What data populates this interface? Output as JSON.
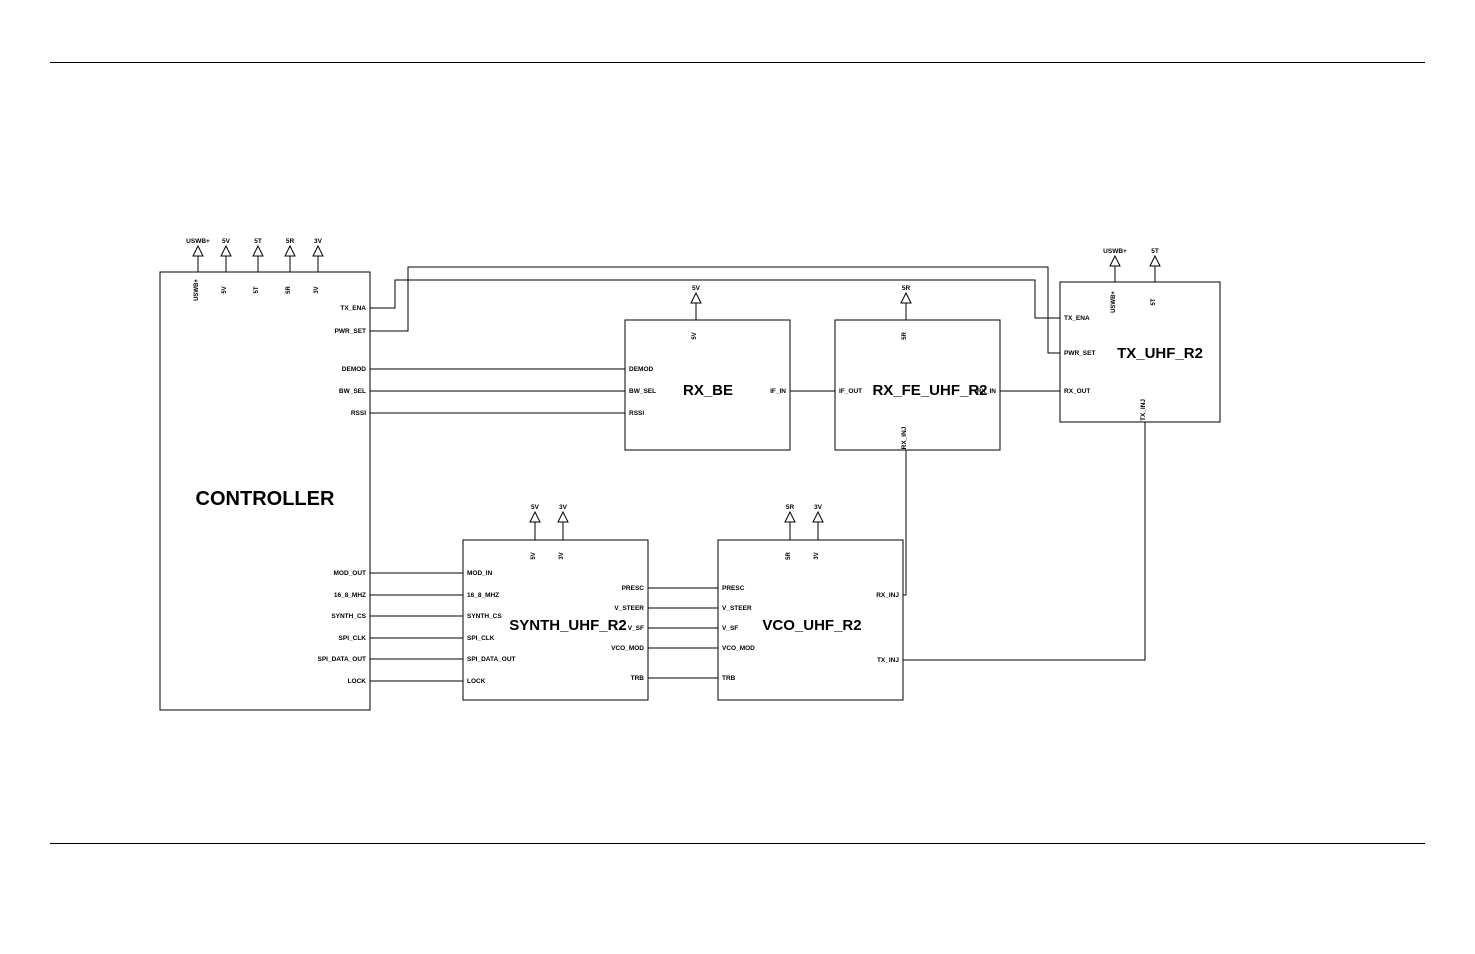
{
  "blocks": {
    "controller": {
      "title": "CONTROLLER",
      "power_ext": [
        "USWB+",
        "5V",
        "5T",
        "5R",
        "3V"
      ],
      "power_int": [
        "USWB+",
        "5V",
        "5T",
        "5R",
        "3V"
      ],
      "pins_right": [
        "TX_ENA",
        "PWR_SET",
        "DEMOD",
        "BW_SEL",
        "RSSI",
        "MOD_OUT",
        "16_8_MHZ",
        "SYNTH_CS",
        "SPI_CLK",
        "SPI_DATA_OUT",
        "LOCK"
      ]
    },
    "rx_be": {
      "title": "RX_BE",
      "power_ext": [
        "5V"
      ],
      "power_int": [
        "5V"
      ],
      "pins_left": [
        "DEMOD",
        "BW_SEL",
        "RSSI"
      ],
      "pins_right": [
        "IF_IN"
      ]
    },
    "rx_fe": {
      "title": "RX_FE_UHF_R2",
      "power_ext": [
        "5R"
      ],
      "power_int": [
        "5R"
      ],
      "pins_left": [
        "IF_OUT"
      ],
      "pins_right": [
        "RX_IN"
      ],
      "pins_bottom": [
        "RX_INJ"
      ]
    },
    "tx": {
      "title": "TX_UHF_R2",
      "power_ext": [
        "USWB+",
        "5T"
      ],
      "power_int": [
        "USWB+",
        "5T"
      ],
      "pins_left": [
        "TX_ENA",
        "PWR_SET",
        "RX_OUT"
      ],
      "pins_bottom": [
        "TX_INJ"
      ]
    },
    "synth": {
      "title": "SYNTH_UHF_R2",
      "power_ext": [
        "5V",
        "3V"
      ],
      "power_int": [
        "5V",
        "3V"
      ],
      "pins_left": [
        "MOD_IN",
        "16_8_MHZ",
        "SYNTH_CS",
        "SPI_CLK",
        "SPI_DATA_OUT",
        "LOCK"
      ],
      "pins_right": [
        "PRESC",
        "V_STEER",
        "V_SF",
        "VCO_MOD",
        "TRB"
      ]
    },
    "vco": {
      "title": "VCO_UHF_R2",
      "power_ext": [
        "5R",
        "3V"
      ],
      "power_int": [
        "5R",
        "3V"
      ],
      "pins_left": [
        "PRESC",
        "V_STEER",
        "V_SF",
        "VCO_MOD",
        "TRB"
      ],
      "pins_right": [
        "RX_INJ",
        "TX_INJ"
      ]
    }
  }
}
